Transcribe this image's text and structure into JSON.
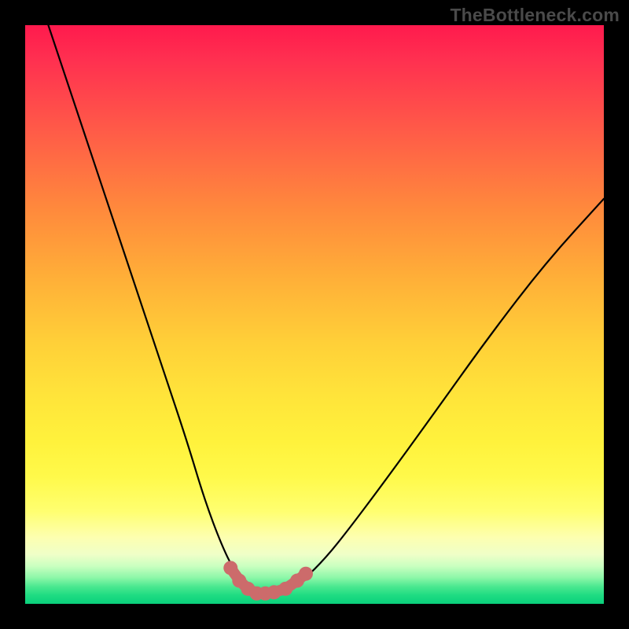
{
  "watermark": "TheBottleneck.com",
  "chart_data": {
    "type": "line",
    "title": "",
    "xlabel": "",
    "ylabel": "",
    "xlim": [
      0,
      100
    ],
    "ylim": [
      0,
      100
    ],
    "series": [
      {
        "name": "bottleneck-curve",
        "x": [
          4,
          8,
          12,
          16,
          20,
          24,
          28,
          31,
          34,
          36.5,
          38.5,
          40.5,
          42.5,
          45,
          48,
          52,
          56,
          62,
          70,
          80,
          90,
          100
        ],
        "y": [
          100,
          88,
          76,
          64,
          52,
          40,
          28,
          18,
          10,
          5,
          2.5,
          1.6,
          1.6,
          2.2,
          4,
          8,
          13,
          21,
          32,
          46,
          59,
          70
        ]
      }
    ],
    "markers": {
      "name": "sweet-spot",
      "x": [
        35.5,
        37,
        38.5,
        40,
        41.5,
        43,
        45,
        47,
        48.5
      ],
      "y": [
        6.2,
        4.0,
        2.6,
        1.8,
        1.8,
        2.0,
        2.6,
        4.0,
        5.2
      ]
    },
    "background_gradient": {
      "top": "#ff1a4d",
      "mid_upper": "#ff8a3c",
      "mid": "#ffe43a",
      "mid_lower": "#fdffb0",
      "bottom": "#0ad07c"
    }
  }
}
